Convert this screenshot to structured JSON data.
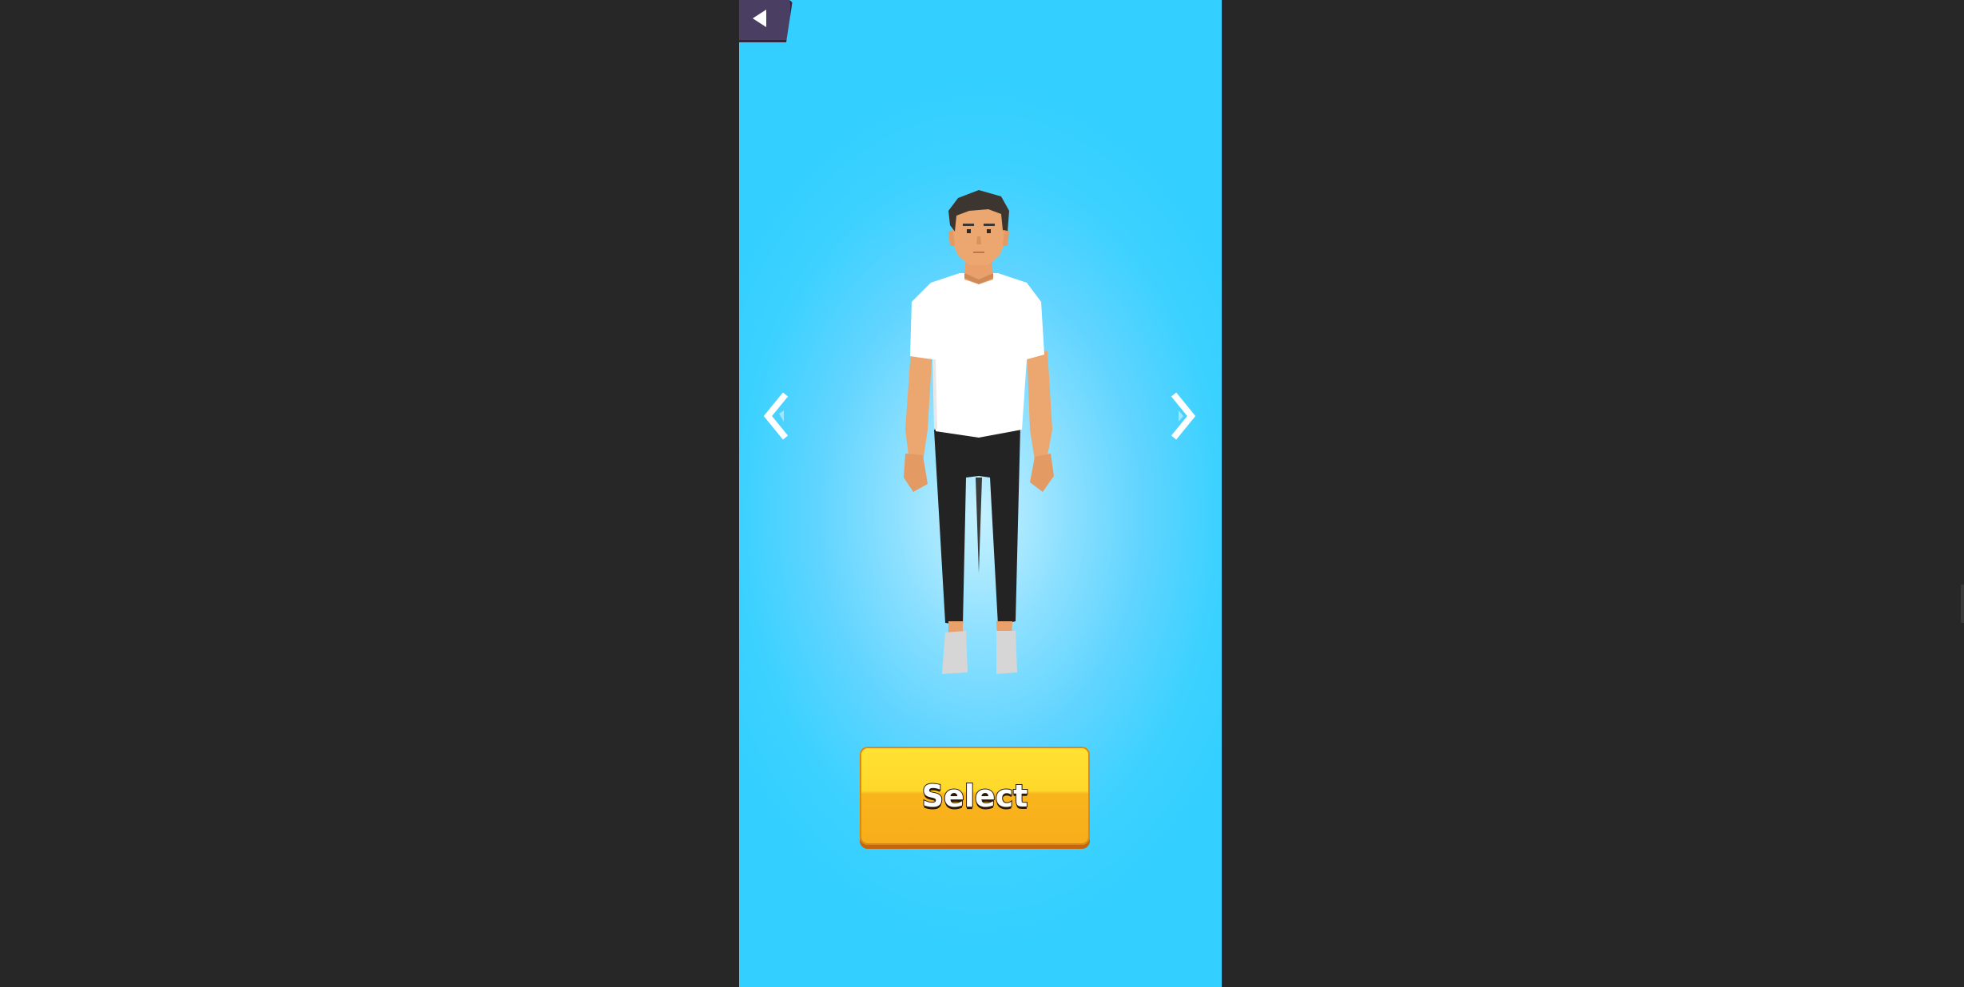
{
  "select_button": {
    "label": "Select"
  },
  "icons": {
    "back": "back-triangle-icon",
    "previous": "chevron-left-icon",
    "next": "chevron-right-icon"
  },
  "colors": {
    "outer_background": "#272727",
    "game_background": "#33cfff",
    "back_button": "#4a3f63",
    "select_button_top": "#ffe233",
    "select_button_bottom": "#f8ad1a",
    "shirt": "#ffffff",
    "pants": "#242424",
    "skin": "#eca66f",
    "hair": "#3d3530",
    "shoes": "#d3d3d3"
  }
}
